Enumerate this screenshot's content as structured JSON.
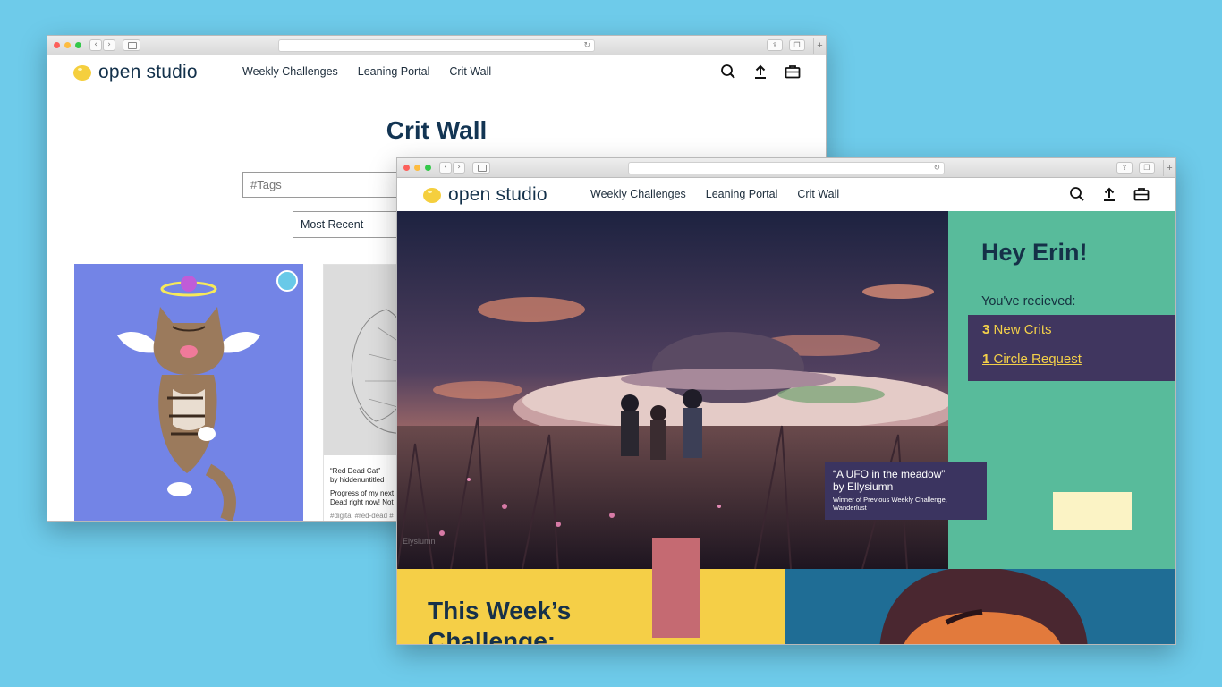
{
  "colors": {
    "background": "#6ecbea",
    "navy": "#12304a",
    "logo_yellow": "#f5cf3e",
    "teal_panel": "#58bb9b",
    "purple_panel": "#40365f",
    "yellow_link": "#f3d049",
    "challenge_yellow": "#f5cf47",
    "cream": "#fbf3c5",
    "pink": "#c56a72"
  },
  "brand": {
    "name": "open studio"
  },
  "nav": {
    "items": [
      "Weekly Challenges",
      "Leaning Portal",
      "Crit Wall"
    ]
  },
  "header_icons": [
    "search-icon",
    "upload-icon",
    "portfolio-icon"
  ],
  "back_window": {
    "page_title": "Crit Wall",
    "tags_placeholder": "#Tags",
    "sort_value": "Most Recent",
    "cards": [
      {
        "image": "angel-cat-illustration",
        "badge_icon": "comment-icon"
      },
      {
        "image": "sketch-illustration",
        "title": "“Red Dead Cat”",
        "author": "by hiddenuntitled",
        "description": "Progress of my next",
        "description_line2": "Dead right now! Not",
        "tags": "#digital #red-dead #"
      }
    ]
  },
  "front_window": {
    "hero": {
      "image": "ufo-in-meadow-painting",
      "caption_title": "“A UFO in the meadow”",
      "caption_author": "by Ellysiumn",
      "caption_note": "Winner of Previous Weekly Challenge, Wanderlust",
      "watermark": "Elysiumn"
    },
    "greeting": {
      "title": "Hey Erin!",
      "subtitle": "You've recieved:",
      "crits_count": "3",
      "crits_label": "New Crits",
      "circle_count": "1",
      "circle_label": "Circle Request"
    },
    "challenge": {
      "title": "This Week’s Challenge:"
    }
  }
}
